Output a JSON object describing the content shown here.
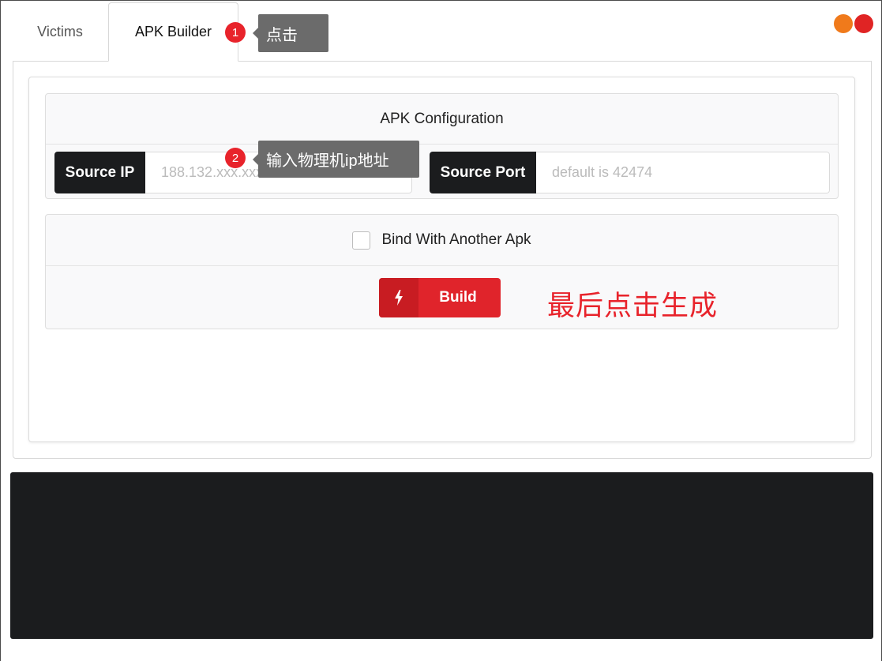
{
  "tabs": [
    {
      "label": "Victims"
    },
    {
      "label": "APK Builder"
    }
  ],
  "window_controls": {
    "colors": [
      "#f07a1b",
      "#e02424"
    ]
  },
  "annotations": {
    "step1": {
      "number": "1",
      "text": "点击"
    },
    "step2": {
      "number": "2",
      "text": "输入物理机ip地址"
    },
    "final": {
      "text": "最后点击生成"
    }
  },
  "config": {
    "title": "APK Configuration",
    "source_ip": {
      "label": "Source IP",
      "placeholder": "188.132.xxx.xxx"
    },
    "source_port": {
      "label": "Source Port",
      "placeholder": "default is 42474"
    }
  },
  "bind": {
    "label": "Bind With Another Apk",
    "checked": false
  },
  "build_button": {
    "label": "Build",
    "icon": "bolt-icon",
    "color": "#e0242b"
  }
}
